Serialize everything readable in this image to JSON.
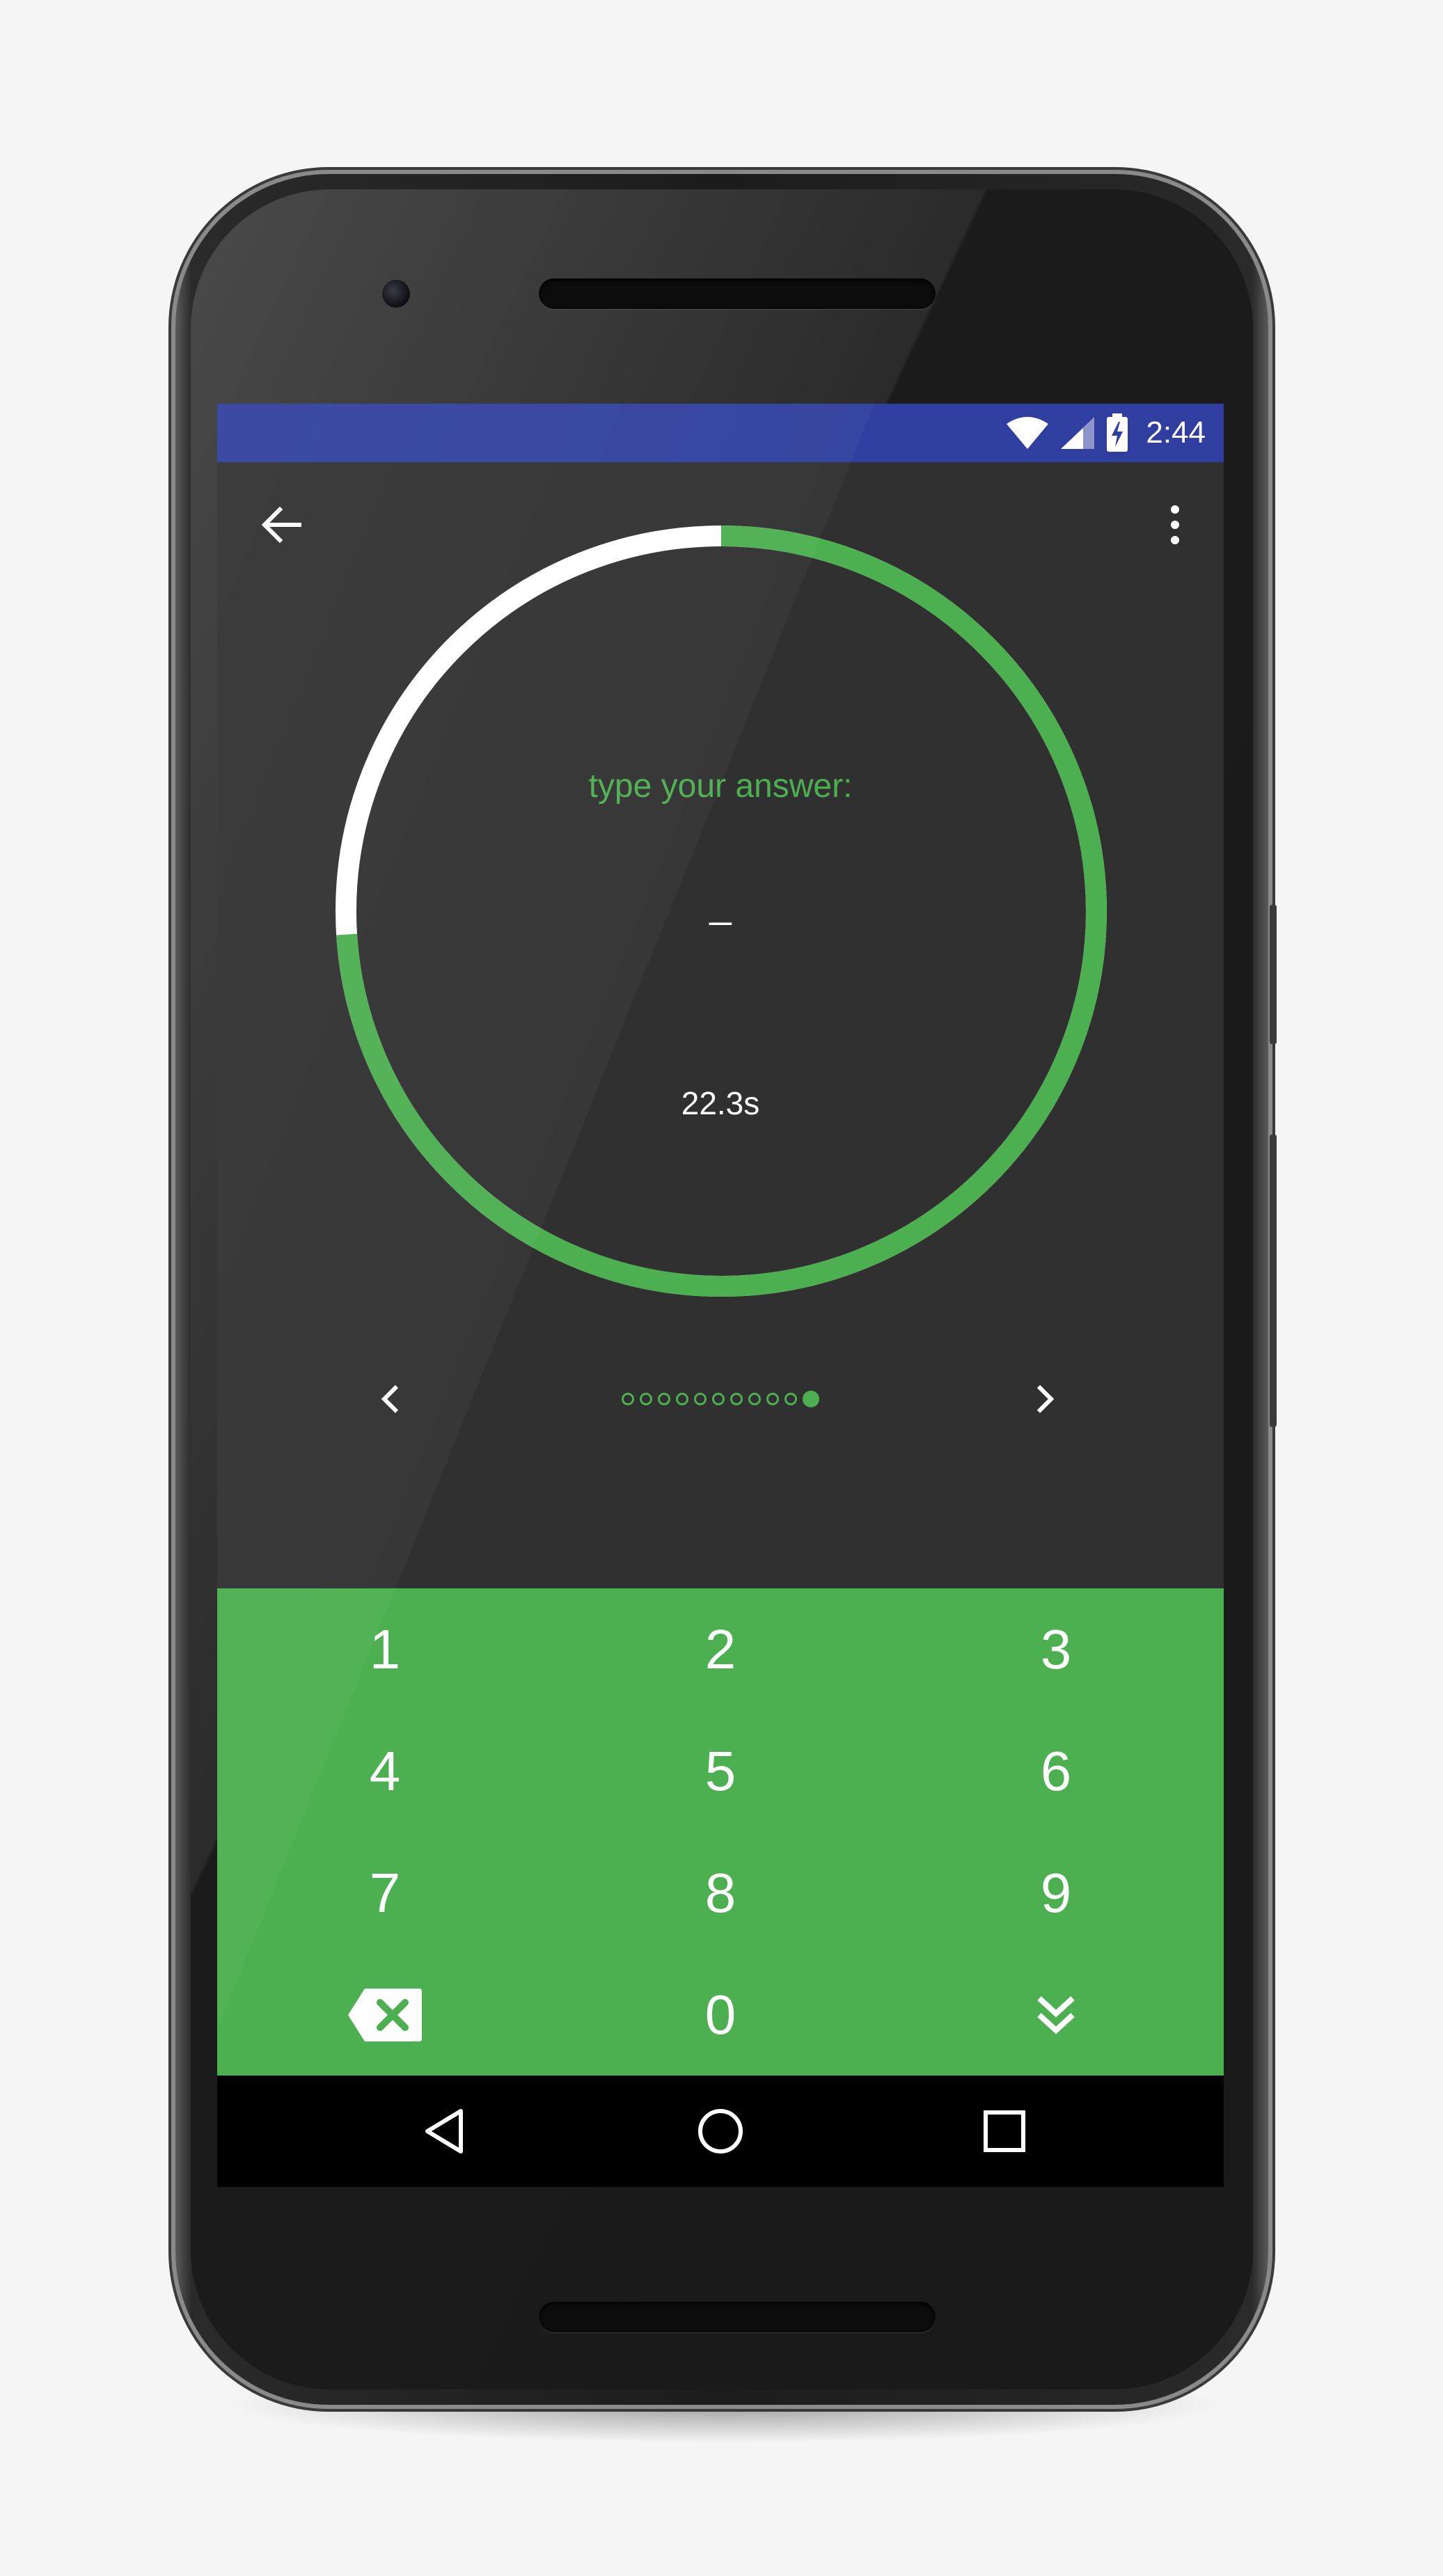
{
  "status_bar": {
    "time": "2:44",
    "icons": [
      "wifi-icon",
      "cell-signal-icon",
      "battery-charging-icon"
    ],
    "color": "#303f9f"
  },
  "app_bar": {
    "back_icon": "arrow-back-icon",
    "menu_icon": "more-vert-icon"
  },
  "question": {
    "prompt": "type your answer:",
    "answer": "_",
    "time_remaining": "22.3s",
    "progress_fraction": 0.74
  },
  "pager": {
    "total": 11,
    "current": 11,
    "prev_icon": "chevron-left-icon",
    "next_icon": "chevron-right-icon"
  },
  "keypad": {
    "keys": [
      "1",
      "2",
      "3",
      "4",
      "5",
      "6",
      "7",
      "8",
      "9",
      "",
      "0",
      ""
    ],
    "backspace_icon": "backspace-icon",
    "hide_icon": "double-chevron-down-icon"
  },
  "navigation": {
    "icons": [
      "nav-back-icon",
      "nav-home-icon",
      "nav-recents-icon"
    ]
  },
  "colors": {
    "accent": "#4caf50",
    "background": "#303030",
    "status_bar": "#303f9f"
  }
}
